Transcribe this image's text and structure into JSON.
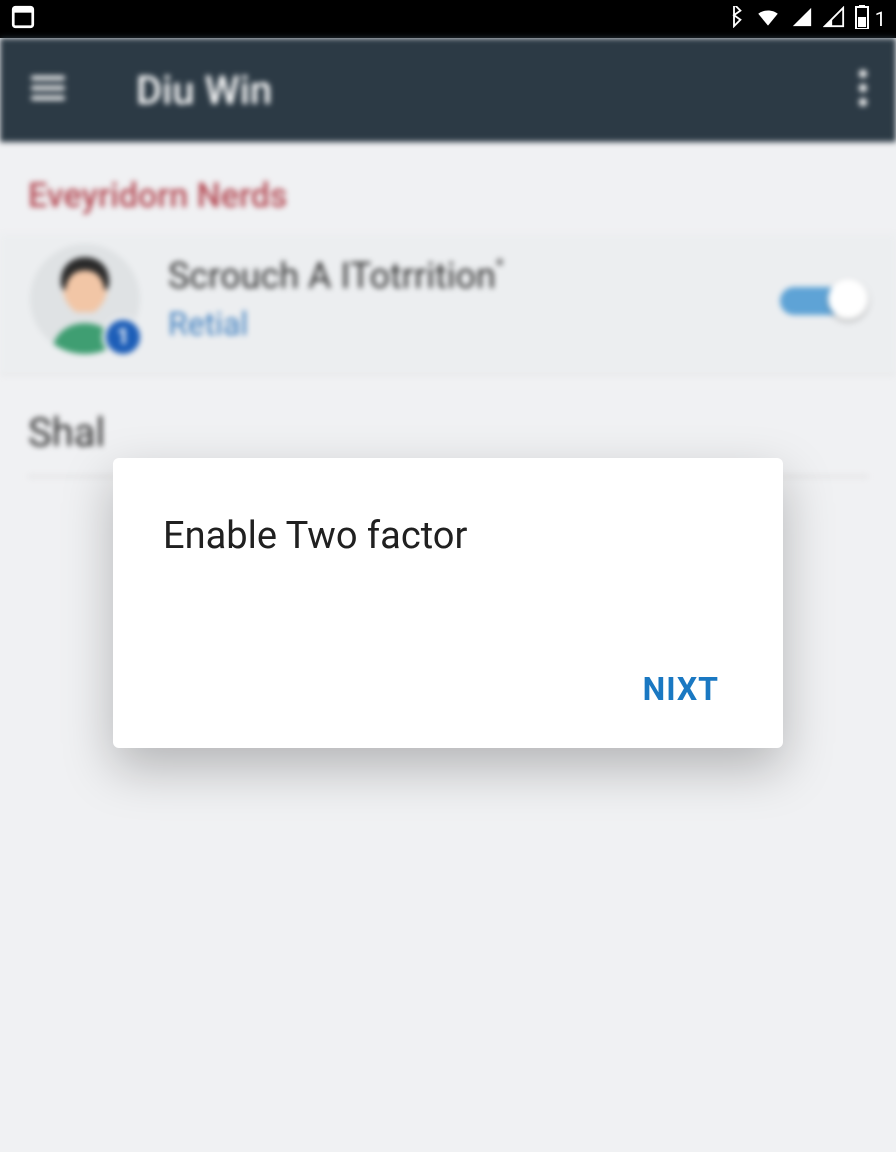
{
  "statusbar": {
    "battery_number": "1"
  },
  "appbar": {
    "title": "Diu Win"
  },
  "section1": {
    "heading": "Eveyridorn Nerds",
    "item": {
      "title": "Scrouch A ITotrrition",
      "title_sup": "*",
      "subtitle": "Retial",
      "badge": "1",
      "switch_on": true
    }
  },
  "section2": {
    "heading": "Shal"
  },
  "dialog": {
    "title": "Enable Two  factor",
    "next_label": "NIXT"
  }
}
